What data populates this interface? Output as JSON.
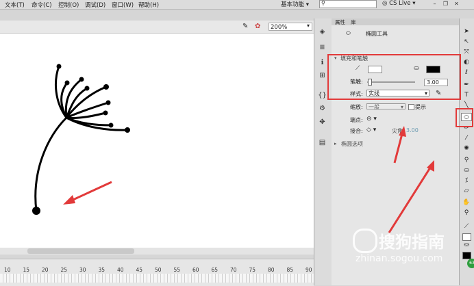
{
  "menubar": {
    "items": [
      "文本(T)",
      "命令(C)",
      "控制(O)",
      "调试(D)",
      "窗口(W)",
      "帮助(H)"
    ],
    "workspace": "基本功能",
    "cs_live": "CS Live"
  },
  "stage": {
    "zoom": "200%"
  },
  "timeline": {
    "ticks": [
      "10",
      "15",
      "20",
      "25",
      "30",
      "35",
      "40",
      "45",
      "50",
      "55",
      "60",
      "65",
      "70",
      "75",
      "80",
      "85",
      "90"
    ]
  },
  "panel": {
    "tabs": [
      "属性",
      "库"
    ],
    "tool_name": "椭圆工具",
    "section_fill_stroke": "填充和笔触",
    "stroke_label": "笔触:",
    "stroke_value": "3.00",
    "style_label": "样式:",
    "style_value": "实线",
    "scale_label": "缩放:",
    "scale_value": "一般",
    "hint_label": "提示",
    "cap_label": "端点:",
    "join_label": "接合:",
    "miter_label": "尖角:",
    "miter_value": "3.00",
    "section_oval_options": "椭圆选项"
  },
  "colors": {
    "fill": "#ffffff",
    "stroke": "#000000",
    "annotation": "#e23a3a"
  },
  "watermark": {
    "text": "搜狗指南",
    "url": "zhinan.sogou.com"
  }
}
